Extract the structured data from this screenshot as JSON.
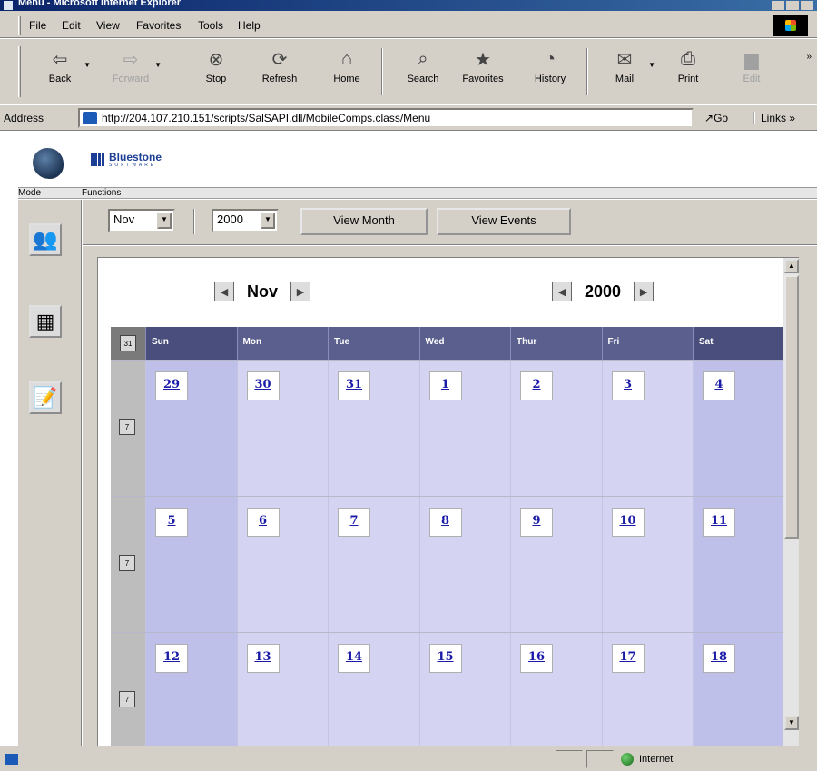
{
  "window": {
    "title": "Menu - Microsoft Internet Explorer"
  },
  "menubar": {
    "items": [
      "File",
      "Edit",
      "View",
      "Favorites",
      "Tools",
      "Help"
    ]
  },
  "toolbar": {
    "buttons": [
      {
        "label": "Back",
        "icon": "back-arrow-icon"
      },
      {
        "label": "Forward",
        "icon": "forward-arrow-icon"
      },
      {
        "label": "Stop",
        "icon": "stop-icon"
      },
      {
        "label": "Refresh",
        "icon": "refresh-icon"
      },
      {
        "label": "Home",
        "icon": "home-icon"
      },
      {
        "label": "Search",
        "icon": "search-icon"
      },
      {
        "label": "Favorites",
        "icon": "favorites-icon"
      },
      {
        "label": "History",
        "icon": "history-icon"
      },
      {
        "label": "Mail",
        "icon": "mail-icon"
      },
      {
        "label": "Print",
        "icon": "print-icon"
      },
      {
        "label": "Edit",
        "icon": "edit-icon"
      }
    ]
  },
  "address": {
    "label": "Address",
    "url": "http://204.107.210.151/scripts/SalSAPI.dll/MobileComps.class/Menu",
    "go_label": "Go",
    "links_label": "Links »"
  },
  "brand": {
    "name": "Bluestone",
    "tagline": "SOFTWARE"
  },
  "section_labels": {
    "mode": "Mode",
    "functions": "Functions"
  },
  "functions": {
    "month_select": "Nov",
    "year_select": "2000",
    "view_month_label": "View Month",
    "view_events_label": "View Events"
  },
  "calendar": {
    "month": "Nov",
    "year": "2000",
    "header_icon_label": "31",
    "week_icon_label": "7",
    "weekdays": [
      "Sun",
      "Mon",
      "Tue",
      "Wed",
      "Thur",
      "Fri",
      "Sat"
    ],
    "weeks": [
      [
        "29",
        "30",
        "31",
        "1",
        "2",
        "3",
        "4"
      ],
      [
        "5",
        "6",
        "7",
        "8",
        "9",
        "10",
        "11"
      ],
      [
        "12",
        "13",
        "14",
        "15",
        "16",
        "17",
        "18"
      ]
    ]
  },
  "statusbar": {
    "zone": "Internet"
  }
}
